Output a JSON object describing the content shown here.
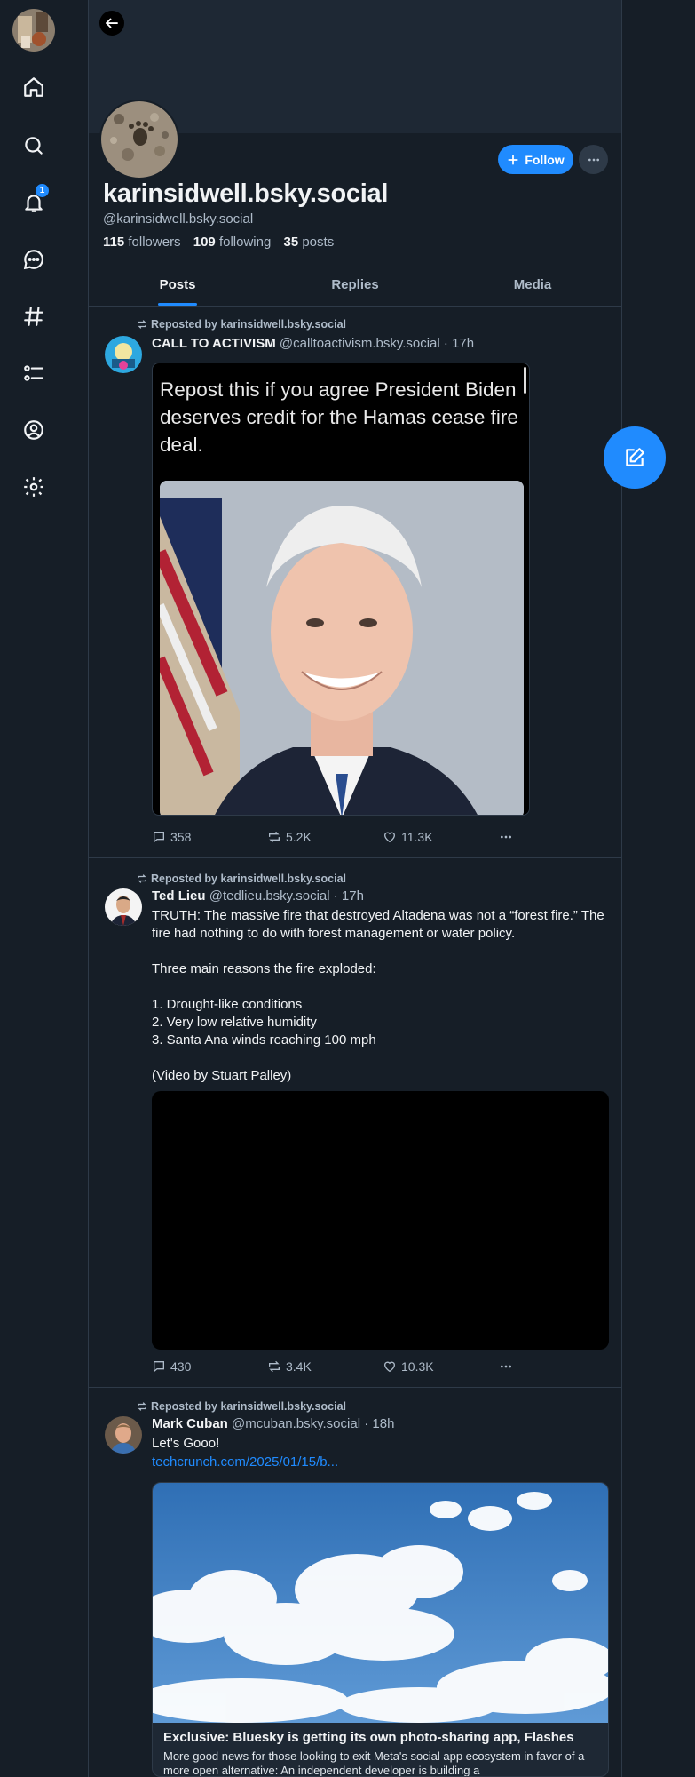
{
  "nav": {
    "notifications_badge": "1",
    "items": [
      "home-icon",
      "search-icon",
      "bell-icon",
      "chat-icon",
      "hashtag-icon",
      "list-icon",
      "profile-icon",
      "gear-icon"
    ]
  },
  "profile": {
    "display_name": "karinsidwell.bsky.social",
    "handle": "@karinsidwell.bsky.social",
    "followers_count": "115",
    "followers_label": "followers",
    "following_count": "109",
    "following_label": "following",
    "posts_count": "35",
    "posts_label": "posts",
    "follow_label": "Follow"
  },
  "tabs": [
    "Posts",
    "Replies",
    "Media"
  ],
  "posts": [
    {
      "repost_label": "Reposted by karinsidwell.bsky.social",
      "author": "CALL TO ACTIVISM",
      "handle": "@calltoactivism.bsky.social",
      "time": "· 17h",
      "image_text": "Repost this if you agree President Biden deserves credit for the Hamas cease fire deal.",
      "replies": "358",
      "reposts": "5.2K",
      "likes": "11.3K"
    },
    {
      "repost_label": "Reposted by karinsidwell.bsky.social",
      "author": "Ted Lieu",
      "handle": "@tedlieu.bsky.social",
      "time": "· 17h",
      "text": "TRUTH: The massive fire that destroyed Altadena was not a “forest fire.” The fire had nothing to do with forest management or water policy.\n\nThree main reasons the fire exploded:\n\n1. Drought-like conditions\n2. Very low relative humidity\n3. Santa Ana winds reaching 100 mph\n\n(Video by Stuart Palley)",
      "replies": "430",
      "reposts": "3.4K",
      "likes": "10.3K"
    },
    {
      "repost_label": "Reposted by karinsidwell.bsky.social",
      "author": "Mark Cuban",
      "handle": "@mcuban.bsky.social",
      "time": "· 18h",
      "text": "Let's Gooo!",
      "link": "techcrunch.com/2025/01/15/b...",
      "card_title": "Exclusive: Bluesky is getting its own photo-sharing app, Flashes",
      "card_desc": "More good news for those looking to exit Meta's social app ecosystem in favor of a more open alternative: An independent developer is building a"
    }
  ]
}
